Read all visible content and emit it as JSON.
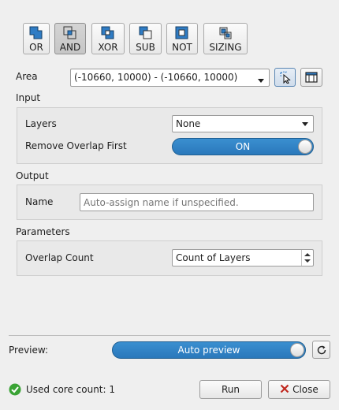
{
  "ops": [
    {
      "label": "OR",
      "icon": "or-icon",
      "active": false
    },
    {
      "label": "AND",
      "icon": "and-icon",
      "active": true
    },
    {
      "label": "XOR",
      "icon": "xor-icon",
      "active": false
    },
    {
      "label": "SUB",
      "icon": "sub-icon",
      "active": false
    },
    {
      "label": "NOT",
      "icon": "not-icon",
      "active": false
    },
    {
      "label": "SIZING",
      "icon": "sizing-icon",
      "active": false
    }
  ],
  "area": {
    "label": "Area",
    "value": "(-10660, 10000) - (-10660, 10000)",
    "pick_icon": "pick-cursor-icon",
    "window_icon": "window-frame-icon"
  },
  "input": {
    "title": "Input",
    "layers_label": "Layers",
    "layers_value": "None",
    "remove_overlap_label": "Remove Overlap First",
    "remove_overlap_state": "ON"
  },
  "output": {
    "title": "Output",
    "name_label": "Name",
    "name_placeholder": "Auto-assign name if unspecified.",
    "name_value": ""
  },
  "parameters": {
    "title": "Parameters",
    "overlap_label": "Overlap Count",
    "overlap_value": "Count of Layers"
  },
  "preview": {
    "label": "Preview:",
    "toggle_text": "Auto preview",
    "refresh_icon": "refresh-icon"
  },
  "status": {
    "icon": "check-circle-icon",
    "text": "Used core count: 1"
  },
  "buttons": {
    "run": "Run",
    "close": "Close",
    "close_icon": "close-x-icon"
  },
  "colors": {
    "toggle_blue": "#2a78bb",
    "status_green": "#3aa335",
    "close_red": "#c0281f"
  }
}
